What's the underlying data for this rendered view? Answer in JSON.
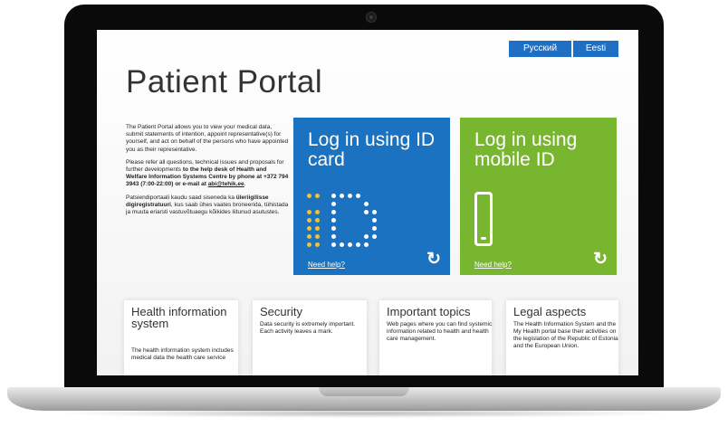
{
  "languages": {
    "russian": "Русский",
    "estonian": "Eesti"
  },
  "page_title": "Patient Portal",
  "intro": {
    "p1": "The Patient Portal allows you to view your medical data, submit statements of intention, appoint representative(s) for yourself, and act on behalf of the persons who have appointed you as their representative.",
    "p2_start": "Please refer all questions, technical issues and proposals for further developments ",
    "p2_bold": "to the help desk of Health and Welfare Information Systems Centre by phone at +372 794 3943 (7:00-22:00) or e-mail at ",
    "email": "abi@tehik.ee",
    "p2_end": ".",
    "p3_start": "Patsiendiportaali kaudu saad siseneda ka ",
    "p3_bold": "üleriigilisse digiregistratuuri",
    "p3_end": ", kus saab ühes vaates broneerida, tühistada ja muuta eriarsti vastuvõtuaegu kõikides liitunud asutustes."
  },
  "login_tiles": {
    "id_card": {
      "title": "Log in using ID card",
      "help": "Need help?",
      "color": "#1b72c0"
    },
    "mobile_id": {
      "title": "Log in using mobile ID",
      "help": "Need help?",
      "color": "#79b62f"
    }
  },
  "cards": [
    {
      "title": "Health information system",
      "text": "The health information system includes medical data the health care service"
    },
    {
      "title": "Security",
      "text": "Data security is extremely important. Each activity leaves a mark."
    },
    {
      "title": "Important topics",
      "text": "Web pages where you can find systemic information related to health and health care management."
    },
    {
      "title": "Legal aspects",
      "text": "The Health Information System and the My Health portal base their activities on the legislation of the Republic of Estonia and the European Union."
    }
  ],
  "icons": {
    "help_arrow": "↻",
    "id_logo": "id-dots-logo",
    "mobile": "mobile-phone-icon"
  }
}
